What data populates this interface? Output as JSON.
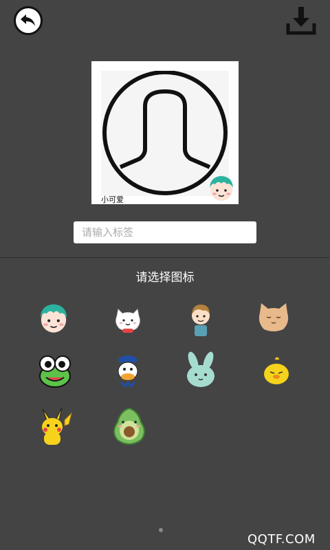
{
  "toolbar": {
    "back_icon": "back-arrow-icon",
    "download_icon": "download-icon"
  },
  "preview": {
    "label": "小可爱",
    "avatar_icon": "default-avatar-icon",
    "badge_icon": "green-hair-boy-sticker"
  },
  "tag_input": {
    "placeholder": "请输入标签",
    "value": ""
  },
  "icon_section": {
    "title": "请选择图标",
    "icons": [
      {
        "name": "green-hair-boy-sticker"
      },
      {
        "name": "white-cat-sticker"
      },
      {
        "name": "brown-hair-boy-sticker"
      },
      {
        "name": "orange-cat-sticker"
      },
      {
        "name": "green-frog-sticker"
      },
      {
        "name": "duck-sailor-sticker"
      },
      {
        "name": "mint-bunny-sticker"
      },
      {
        "name": "yellow-chick-sticker"
      },
      {
        "name": "pikachu-sticker"
      },
      {
        "name": "avocado-sticker"
      }
    ]
  },
  "pager": {
    "current": 1,
    "total": 1
  },
  "watermark": "QQTF.COM",
  "colors": {
    "background": "#444444",
    "input_bg": "#ffffff",
    "text": "#ffffff"
  }
}
